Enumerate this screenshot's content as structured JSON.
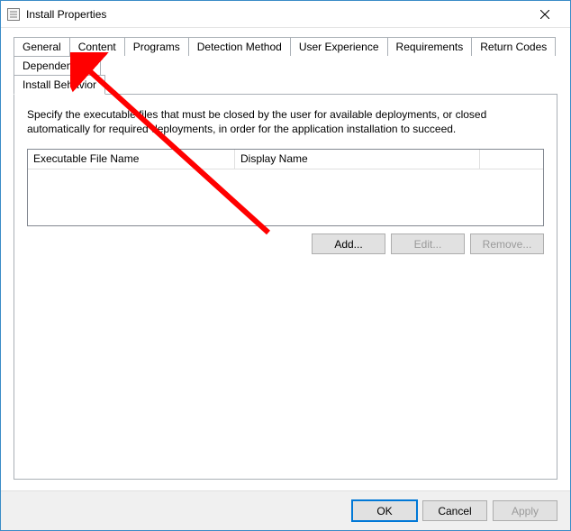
{
  "window": {
    "title": "Install Properties"
  },
  "tabs": {
    "row1": [
      {
        "label": "General"
      },
      {
        "label": "Content"
      },
      {
        "label": "Programs"
      },
      {
        "label": "Detection Method"
      },
      {
        "label": "User Experience"
      },
      {
        "label": "Requirements"
      },
      {
        "label": "Return Codes"
      },
      {
        "label": "Dependencies"
      }
    ],
    "row2": [
      {
        "label": "Install Behavior",
        "active": true
      }
    ]
  },
  "panel": {
    "description": "Specify the executable files that must be closed by the user for available deployments, or closed automatically for required deployments, in order for the application installation to succeed.",
    "columns": {
      "col1": "Executable File Name",
      "col2": "Display Name",
      "col3": ""
    },
    "buttons": {
      "add": "Add...",
      "edit": "Edit...",
      "remove": "Remove..."
    }
  },
  "dialog": {
    "ok": "OK",
    "cancel": "Cancel",
    "apply": "Apply"
  }
}
